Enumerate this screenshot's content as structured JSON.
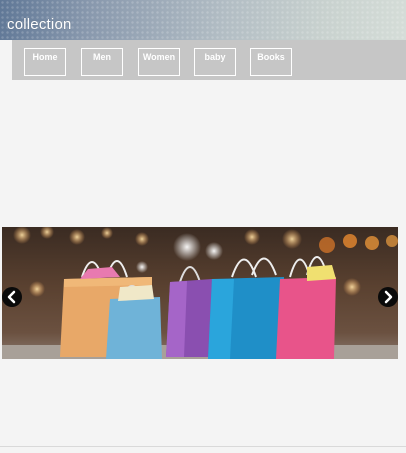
{
  "header": {
    "title": "collection"
  },
  "nav": {
    "items": [
      {
        "label": "Home"
      },
      {
        "label": "Men"
      },
      {
        "label": "Women"
      },
      {
        "label": "baby"
      },
      {
        "label": "Books"
      }
    ]
  },
  "carousel": {
    "image": "shopping-bags-photo",
    "prev_icon": "chevron-left-icon",
    "next_icon": "chevron-right-icon"
  }
}
